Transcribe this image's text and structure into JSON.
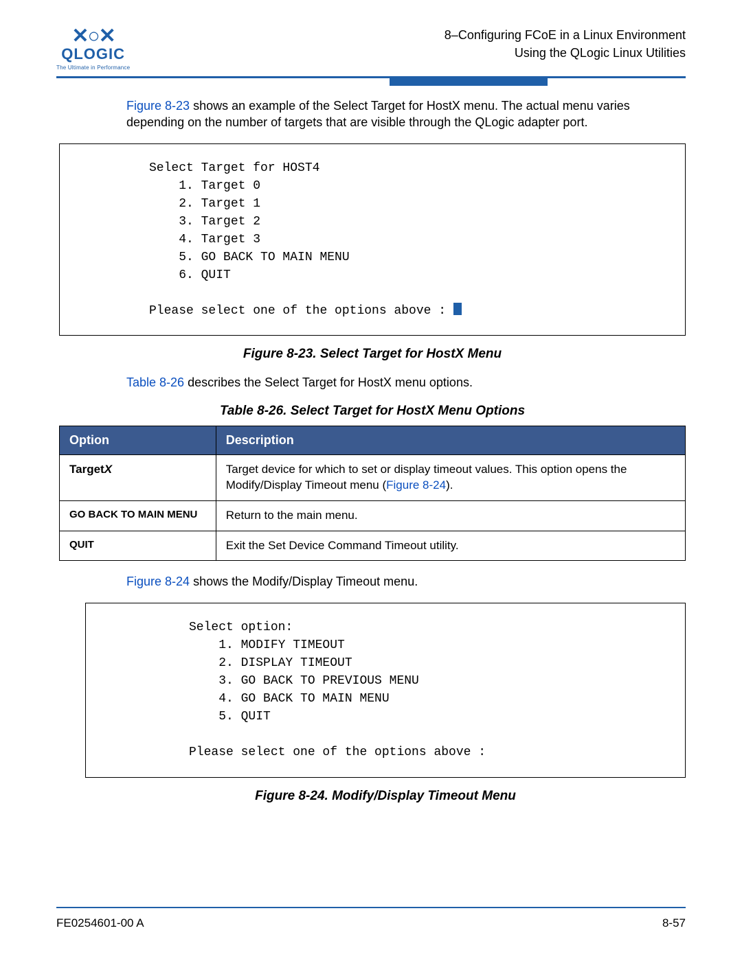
{
  "logo": {
    "word": "QLOGIC",
    "tagline": "The Ultimate in Performance"
  },
  "header": {
    "line1": "8–Configuring FCoE in a Linux Environment",
    "line2": "Using the QLogic Linux Utilities"
  },
  "para1": {
    "link": "Figure 8-23",
    "rest": " shows an example of the Select Target for HostX menu. The actual menu varies depending on the number of targets that are visible through the QLogic adapter port."
  },
  "fig1": {
    "lines": [
      "Select Target for HOST4",
      "    1. Target 0",
      "    2. Target 1",
      "    3. Target 2",
      "    4. Target 3",
      "    5. GO BACK TO MAIN MENU",
      "    6. QUIT",
      "",
      "Please select one of the options above : "
    ],
    "caption": "Figure 8-23. Select Target for HostX Menu"
  },
  "para2": {
    "link": "Table 8-26",
    "rest": " describes the Select Target for HostX menu options."
  },
  "table": {
    "caption": "Table 8-26. Select Target for HostX Menu Options",
    "head": {
      "c1": "Option",
      "c2": "Description"
    },
    "rows": [
      {
        "opt_pre": "Target",
        "opt_ital": "X",
        "desc_pre": "Target device for which to set or display timeout values. This option opens the Modify/Display Timeout menu (",
        "desc_link": "Figure 8-24",
        "desc_post": ")."
      },
      {
        "opt": "GO BACK TO MAIN MENU",
        "desc": "Return to the main menu."
      },
      {
        "opt": "QUIT",
        "desc": "Exit the Set Device Command Timeout utility."
      }
    ]
  },
  "para3": {
    "link": "Figure 8-24",
    "rest": " shows the Modify/Display Timeout menu."
  },
  "fig2": {
    "lines": [
      "Select option:",
      "    1. MODIFY TIMEOUT",
      "    2. DISPLAY TIMEOUT",
      "    3. GO BACK TO PREVIOUS MENU",
      "    4. GO BACK TO MAIN MENU",
      "    5. QUIT",
      "",
      "Please select one of the options above :"
    ],
    "caption": "Figure 8-24. Modify/Display Timeout Menu"
  },
  "footer": {
    "left": "FE0254601-00 A",
    "right": "8-57"
  }
}
